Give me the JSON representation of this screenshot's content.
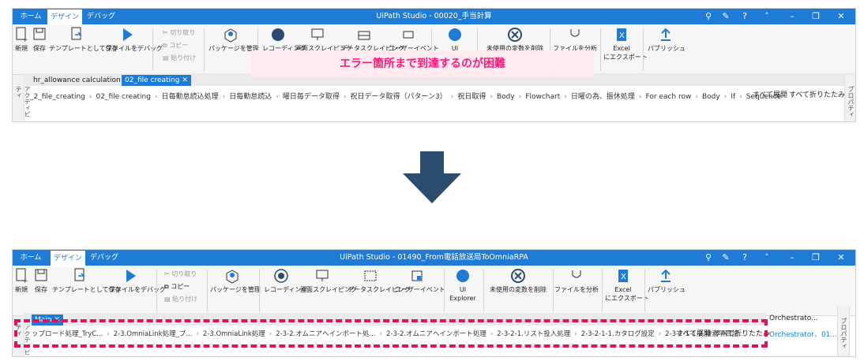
{
  "top": {
    "tabs": [
      "ホーム",
      "デザイン",
      "デバッグ"
    ],
    "title": "UiPath Studio - 00020_手当計算",
    "ribbon": [
      "新規",
      "保存",
      "テンプレートとして保存",
      "ファイルをデバッグ",
      "パッケージを管理",
      "レコーディング",
      "画面スクレイピング",
      "データスクレイピング",
      "ユーザーイベント",
      "UI",
      "未使用の変数を削除",
      "ファイルを分析",
      "Excel",
      "にエクスポート",
      "パブリッシュ"
    ],
    "clip": [
      "切り取り",
      "コピー",
      "貼り付け"
    ],
    "doc_tabs": [
      "hr_allowance calculation",
      "02_file creating"
    ],
    "breadcrumb": [
      "_2_file_creating",
      "02_file creating",
      "日毎勤怠読込処理",
      "日毎勤怠読込",
      "曜日毎データ取得",
      "祝日データ取得（パターン3）",
      "祝日取得",
      "Body",
      "Flowchart",
      "日曜の為、振休処理",
      "For each row",
      "Body",
      "If",
      "Sequence"
    ],
    "expand": "すべて展開",
    "collapse": "すべて折りたたみ",
    "side_left": "アクティビティ",
    "side_right": "プロパティ"
  },
  "banner": "エラー箇所まで到達するのが困難",
  "bottom": {
    "tabs": [
      "ホーム",
      "デザイン",
      "デバッグ"
    ],
    "title": "UiPath Studio - 01490_From電話放送局ToOmniaRPA",
    "ribbon": [
      "新規",
      "保存",
      "テンプレートとして保存",
      "ファイルをデバッグ",
      "パッケージを管理",
      "レコーディング",
      "画面スクレイピング",
      "データスクレイピング",
      "ユーザーイベント",
      "UI",
      "Explorer",
      "未使用の変数を削除",
      "ファイルを分析",
      "Excel",
      "にエクスポート",
      "パブリッシュ"
    ],
    "clip": [
      "切り取り",
      "コピー",
      "貼り付け"
    ],
    "doc_tabs": [
      "Main"
    ],
    "breadcrumb": [
      "ップロード処理_TryC...",
      "2-3.OmniaLink処理_ブ...",
      "2-3.OmniaLink処理",
      "2-3-2.オムニアへインポート処...",
      "2-3-2.オムニアへインポート処理",
      "2-3-2-1.リスト投入処理",
      "2-3-2-1-1.カタログ設定",
      "2-3-2-1-1-2.検索項目記..."
    ],
    "expand": "すべて展開",
    "collapse": "すべて折りたたみ",
    "right_panel": "Orchestrato...",
    "right_text": "Orchestrator、01...",
    "side_left": "アクティビティ",
    "side_right": "プロパティ"
  },
  "colors": {
    "accent": "#1e7cd6",
    "highlight": "#e0115f",
    "arrow": "#2d4d70"
  }
}
